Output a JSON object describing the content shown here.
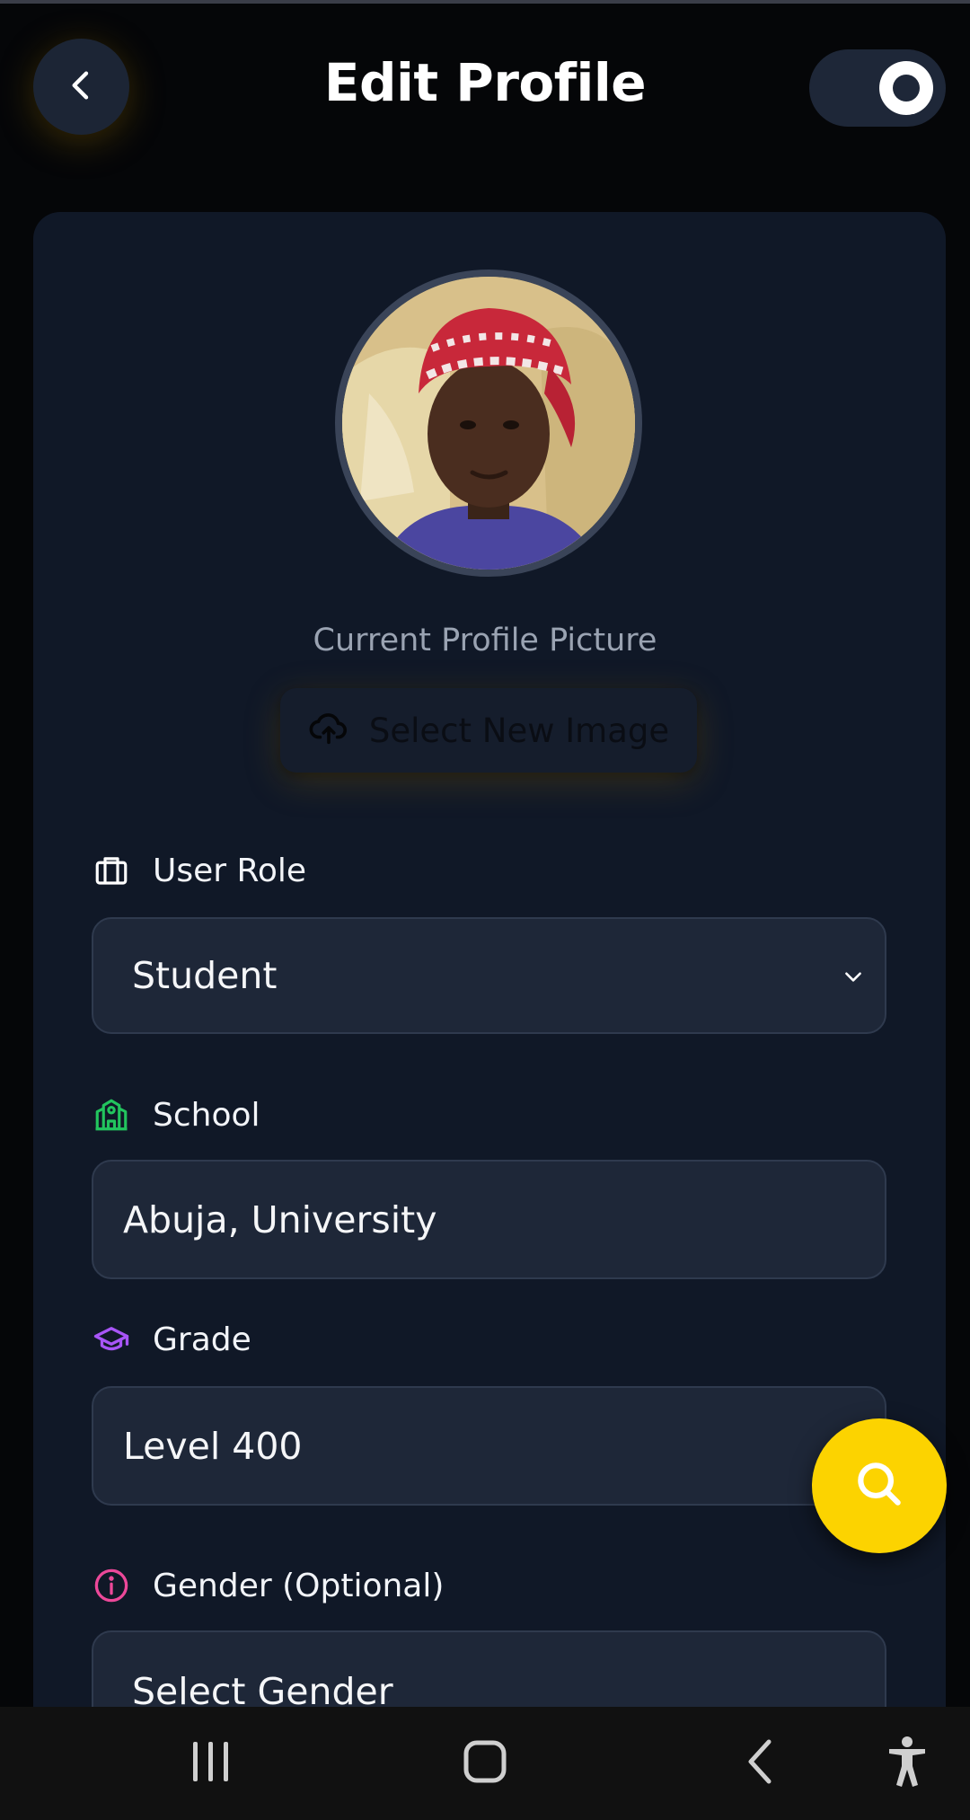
{
  "header": {
    "title": "Edit Profile",
    "back_icon": "chevron-left-icon",
    "theme_toggle_state": "on"
  },
  "profile": {
    "avatar_icon": "profile-photo",
    "caption": "Current Profile Picture",
    "upload_label": "Select New Image",
    "upload_icon": "cloud-upload-icon"
  },
  "fields": {
    "role": {
      "label": "User Role",
      "icon": "briefcase-icon",
      "value": "Student",
      "icon_color": "#ffffff"
    },
    "school": {
      "label": "School",
      "icon": "school-building-icon",
      "value": "Abuja, University",
      "icon_color": "#22c55e"
    },
    "grade": {
      "label": "Grade",
      "icon": "graduation-cap-icon",
      "value": "Level 400",
      "icon_color": "#a855f7"
    },
    "gender": {
      "label": "Gender (Optional)",
      "icon": "info-circle-icon",
      "value": "Select Gender",
      "icon_color": "#ec4899"
    }
  },
  "fab": {
    "icon": "search-icon",
    "color": "#fcd300"
  },
  "navbar": {
    "icons": [
      "recent-apps-icon",
      "home-icon",
      "back-icon",
      "accessibility-icon"
    ]
  },
  "colors": {
    "background": "#050608",
    "card": "#101827",
    "input": "#1e2738",
    "accent": "#fcd300"
  }
}
